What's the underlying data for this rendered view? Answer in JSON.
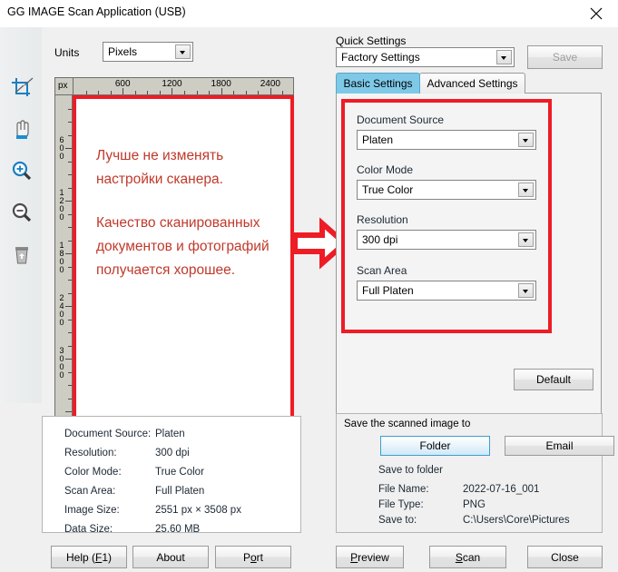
{
  "window": {
    "title": "GG IMAGE Scan Application (USB)",
    "close_icon": "close-icon"
  },
  "toolbar": {
    "items": [
      {
        "icon": "crop-icon",
        "name": "crop-tool"
      },
      {
        "icon": "hand-icon",
        "name": "pan-tool"
      },
      {
        "icon": "zoom-in-icon",
        "name": "zoom-in-tool"
      },
      {
        "icon": "zoom-out-icon",
        "name": "zoom-out-tool"
      },
      {
        "icon": "trash-icon",
        "name": "delete-tool"
      }
    ]
  },
  "units": {
    "label": "Units",
    "value": "Pixels"
  },
  "ruler": {
    "corner_label": "px",
    "h_ticks": [
      600,
      1200,
      1800,
      2400
    ],
    "v_ticks": [
      600,
      1200,
      1800,
      2400,
      3000
    ]
  },
  "preview": {
    "note_lines": [
      "Лучше не изменять настройки сканера.",
      "Качество сканированных документов и фотографий получается хорошее."
    ],
    "note_color": "#c0392b",
    "highlight_color": "#ee1c25"
  },
  "quick_settings": {
    "label": "Quick Settings",
    "value": "Factory Settings",
    "save_label": "Save",
    "save_disabled": true
  },
  "tabs": [
    {
      "label": "Basic Settings",
      "active": true
    },
    {
      "label": "Advanced Settings",
      "active": false
    }
  ],
  "basic_settings": {
    "fields": [
      {
        "label": "Document Source",
        "value": "Platen"
      },
      {
        "label": "Color Mode",
        "value": "True Color"
      },
      {
        "label": "Resolution",
        "value": "300 dpi"
      },
      {
        "label": "Scan Area",
        "value": "Full Platen"
      }
    ],
    "default_label": "Default"
  },
  "summary": {
    "rows": [
      {
        "key": "Document Source:",
        "value": "Platen"
      },
      {
        "key": "Resolution:",
        "value": "300 dpi"
      },
      {
        "key": "Color Mode:",
        "value": "True Color"
      },
      {
        "key": "Scan Area:",
        "value": "Full Platen"
      },
      {
        "key": "Image Size:",
        "value": "2551 px × 3508 px"
      },
      {
        "key": "Data Size:",
        "value": "25.60 MB"
      }
    ]
  },
  "save_panel": {
    "title": "Save the scanned image to",
    "folder_label": "Folder",
    "email_label": "Email",
    "subtitle": "Save to folder",
    "rows": [
      {
        "key": "File Name:",
        "value": "2022-07-16_001"
      },
      {
        "key": "File Type:",
        "value": "PNG"
      },
      {
        "key": "Save to:",
        "value": "C:\\Users\\Core\\Pictures"
      }
    ]
  },
  "footer": {
    "help_pre": "Help (",
    "help_accel": "F",
    "help_post": "1)",
    "about_label": "About",
    "port_pre": "P",
    "port_accel": "o",
    "port_post": "rt",
    "preview_accel": "P",
    "preview_post": "review",
    "scan_accel": "S",
    "scan_post": "can",
    "close_label": "Close"
  },
  "colors": {
    "accent_tab": "#7fc9e8",
    "red": "#ee1c25",
    "window_bg": "#f0f0f0"
  }
}
